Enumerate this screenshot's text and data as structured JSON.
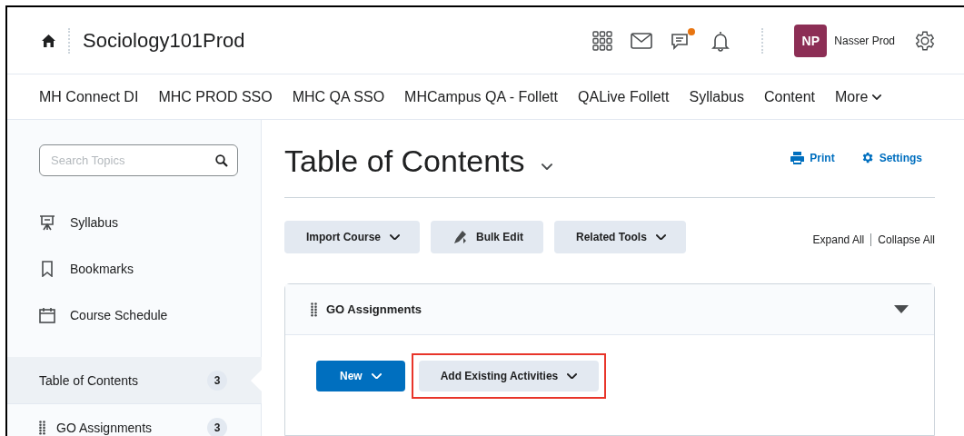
{
  "header": {
    "course_title": "Sociology101Prod",
    "chat_unread": true,
    "user": {
      "initials": "NP",
      "name": "Nasser Prod"
    }
  },
  "nav": [
    "MH Connect DI",
    "MHC PROD SSO",
    "MHC QA SSO",
    "MHCampus QA - Follett",
    "QALive Follett",
    "Syllabus",
    "Content",
    "More"
  ],
  "sidebar": {
    "search": {
      "placeholder": "Search Topics"
    },
    "tools": [
      {
        "label": "Syllabus",
        "kind": "easel"
      },
      {
        "label": "Bookmarks",
        "kind": "bookmark"
      },
      {
        "label": "Course Schedule",
        "kind": "calendar"
      }
    ],
    "modules": [
      {
        "label": "Table of Contents",
        "count": "3",
        "selected": true,
        "draggable": false
      },
      {
        "label": "GO Assignments",
        "count": "3",
        "selected": false,
        "draggable": true
      }
    ]
  },
  "main": {
    "title": "Table of Contents",
    "links": [
      {
        "label": "Print",
        "kind": "printer"
      },
      {
        "label": "Settings",
        "kind": "gear"
      }
    ],
    "toolbar": [
      {
        "label": "Import Course",
        "kind": "menu",
        "dropdown": true
      },
      {
        "label": "Bulk Edit",
        "kind": "edit",
        "dropdown": false
      },
      {
        "label": "Related Tools",
        "kind": "menu",
        "dropdown": true
      }
    ],
    "expand": "Expand All",
    "collapse": "Collapse All",
    "module": {
      "title": "GO Assignments",
      "expanded": true,
      "buttons": [
        {
          "label": "New",
          "primary": true,
          "highlighted": false
        },
        {
          "label": "Add Existing Activities",
          "primary": false,
          "highlighted": true
        }
      ]
    }
  }
}
